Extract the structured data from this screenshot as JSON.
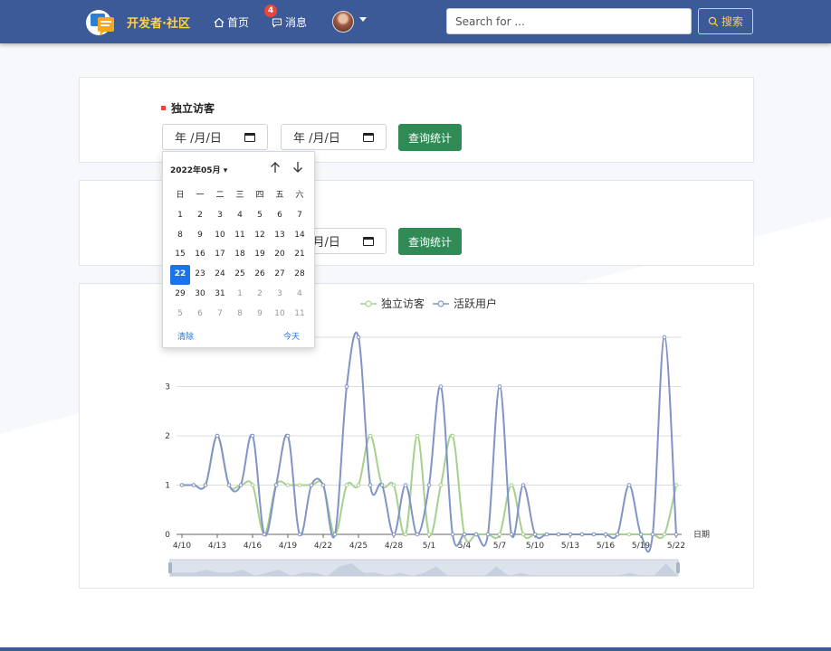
{
  "nav": {
    "brand": "开发者·社区",
    "home": "首页",
    "messages": "消息",
    "message_count": "4",
    "search_placeholder": "Search for ...",
    "search_button": "搜索"
  },
  "stats": {
    "section_title": "独立访客",
    "date_placeholder": "年 /月/日",
    "query_button": "查询统计"
  },
  "calendar": {
    "month_label": "2022年05月 ▾",
    "weekdays": [
      "日",
      "一",
      "二",
      "三",
      "四",
      "五",
      "六"
    ],
    "days": [
      {
        "d": "1"
      },
      {
        "d": "2"
      },
      {
        "d": "3"
      },
      {
        "d": "4"
      },
      {
        "d": "5"
      },
      {
        "d": "6"
      },
      {
        "d": "7"
      },
      {
        "d": "8"
      },
      {
        "d": "9"
      },
      {
        "d": "10"
      },
      {
        "d": "11"
      },
      {
        "d": "12"
      },
      {
        "d": "13"
      },
      {
        "d": "14"
      },
      {
        "d": "15"
      },
      {
        "d": "16"
      },
      {
        "d": "17"
      },
      {
        "d": "18"
      },
      {
        "d": "19"
      },
      {
        "d": "20"
      },
      {
        "d": "21"
      },
      {
        "d": "22",
        "selected": true
      },
      {
        "d": "23"
      },
      {
        "d": "24"
      },
      {
        "d": "25"
      },
      {
        "d": "26"
      },
      {
        "d": "27"
      },
      {
        "d": "28"
      },
      {
        "d": "29"
      },
      {
        "d": "30"
      },
      {
        "d": "31"
      },
      {
        "d": "1",
        "muted": true
      },
      {
        "d": "2",
        "muted": true
      },
      {
        "d": "3",
        "muted": true
      },
      {
        "d": "4",
        "muted": true
      },
      {
        "d": "5",
        "muted": true
      },
      {
        "d": "6",
        "muted": true
      },
      {
        "d": "7",
        "muted": true
      },
      {
        "d": "8",
        "muted": true
      },
      {
        "d": "9",
        "muted": true
      },
      {
        "d": "10",
        "muted": true
      },
      {
        "d": "11",
        "muted": true
      }
    ],
    "clear_label": "清除",
    "today_label": "今天"
  },
  "chart_data": {
    "type": "line",
    "xlabel": "日期",
    "ylim": [
      0,
      4
    ],
    "yticks": [
      0,
      1,
      2,
      3
    ],
    "x": [
      "4/10",
      "4/11",
      "4/12",
      "4/13",
      "4/14",
      "4/15",
      "4/16",
      "4/17",
      "4/18",
      "4/19",
      "4/20",
      "4/21",
      "4/22",
      "4/23",
      "4/24",
      "4/25",
      "4/26",
      "4/27",
      "4/28",
      "4/29",
      "4/30",
      "5/1",
      "5/2",
      "5/3",
      "5/4",
      "5/5",
      "5/6",
      "5/7",
      "5/8",
      "5/9",
      "5/10",
      "5/11",
      "5/12",
      "5/13",
      "5/14",
      "5/15",
      "5/16",
      "5/17",
      "5/18",
      "5/19",
      "5/20",
      "5/21",
      "5/22"
    ],
    "x_ticks_shown": [
      "4/10",
      "4/13",
      "4/16",
      "4/19",
      "4/22",
      "4/25",
      "4/28",
      "5/1",
      "5/4",
      "5/7",
      "5/10",
      "5/13",
      "5/16",
      "5/19",
      "5/22"
    ],
    "series": [
      {
        "name": "独立访客",
        "color": "#a6d08e",
        "values": [
          1,
          1,
          1,
          2,
          1,
          1,
          1,
          0,
          1,
          1,
          1,
          1,
          1,
          0,
          1,
          1,
          2,
          1,
          1,
          0,
          2,
          0,
          1,
          2,
          0,
          0,
          0,
          0,
          1,
          0,
          0,
          0,
          0,
          0,
          0,
          0,
          0,
          0,
          0,
          0,
          0,
          0,
          1
        ]
      },
      {
        "name": "活跃用户",
        "color": "#8094c8",
        "values": [
          1,
          1,
          1,
          2,
          1,
          1,
          2,
          0,
          1,
          2,
          0,
          1,
          1,
          0,
          3,
          4,
          1,
          1,
          0,
          1,
          0,
          1,
          3,
          0,
          0,
          0,
          0,
          3,
          0,
          1,
          0,
          0,
          0,
          0,
          0,
          0,
          0,
          0,
          1,
          0,
          0,
          4,
          0
        ]
      }
    ]
  }
}
